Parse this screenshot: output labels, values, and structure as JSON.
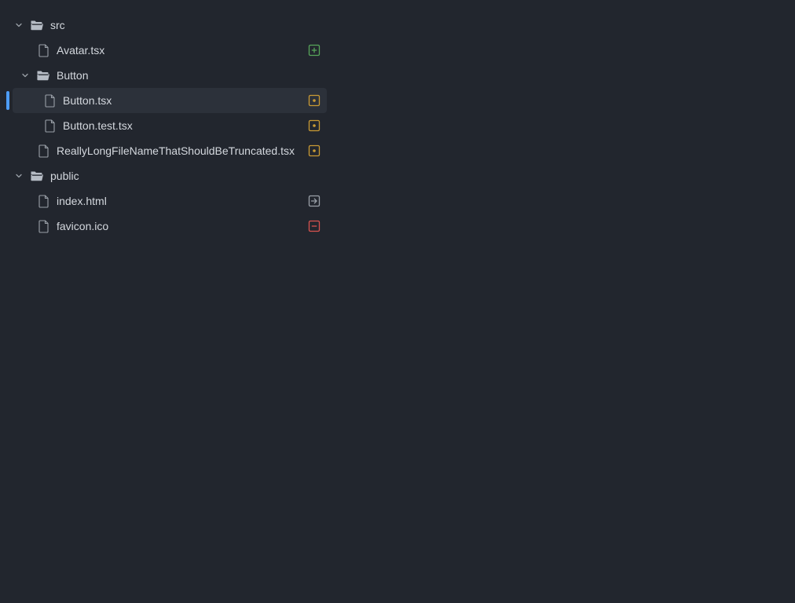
{
  "colors": {
    "background": "#22262e",
    "selected_row": "#2c313a",
    "focus_accent": "#4d9cf6",
    "status_added": "#57a55a",
    "status_modified": "#c99a34",
    "status_renamed": "#9aa0a8",
    "status_deleted": "#d9534f"
  },
  "tree": {
    "src": {
      "label": "src",
      "icon": "folder-open-icon"
    },
    "avatar": {
      "label": "Avatar.tsx",
      "icon": "file-icon",
      "status": "added"
    },
    "button_folder": {
      "label": "Button",
      "icon": "folder-open-icon"
    },
    "button_tsx": {
      "label": "Button.tsx",
      "icon": "file-icon",
      "status": "modified",
      "selected": true
    },
    "button_test": {
      "label": "Button.test.tsx",
      "icon": "file-icon",
      "status": "modified"
    },
    "long_file": {
      "label": "ReallyLongFileNameThatShouldBeTruncated.tsx",
      "icon": "file-icon",
      "status": "modified"
    },
    "public": {
      "label": "public",
      "icon": "folder-open-icon"
    },
    "index_html": {
      "label": "index.html",
      "icon": "file-icon",
      "status": "renamed"
    },
    "favicon": {
      "label": "favicon.ico",
      "icon": "file-icon",
      "status": "deleted"
    }
  }
}
